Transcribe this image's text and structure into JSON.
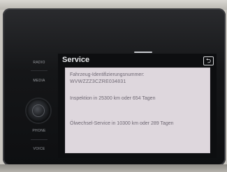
{
  "screen": {
    "title": "Service",
    "back_icon": "back-arrow-icon",
    "panel": {
      "vin_label": "Fahrzeug-Identifizierungsnummer:",
      "vin_value": "WVWZZZ3CZRE034831",
      "inspection": "Inspektion in 25300 km oder 654 Tagen",
      "oil_service": "Ölwechsel-Service in 10300 km oder 289 Tagen"
    }
  },
  "side_buttons": {
    "radio": "RADIO",
    "media": "MEDIA",
    "phone": "PHONE",
    "voice": "VOICE"
  }
}
